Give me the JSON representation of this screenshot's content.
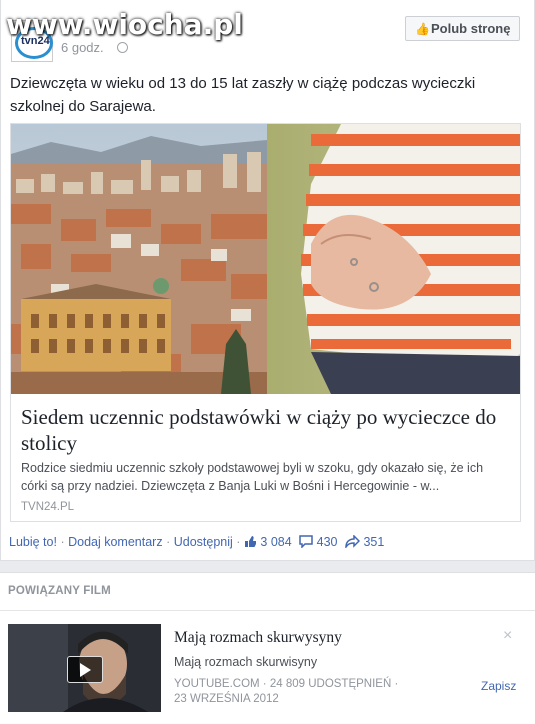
{
  "watermark": "www.wiocha.pl",
  "post": {
    "page_avatar_label": "tvn24",
    "timestamp": "6 godz.",
    "like_page_label": "Polub stronę",
    "status_text": "Dziewczęta w wieku od 13 do 15 lat zaszły w ciążę podczas wycieczki szkolnej do Sarajewa.",
    "link": {
      "title": "Siedem uczennic podstawówki w ciąży po wycieczce do stolicy",
      "description": "Rodzice siedmiu uczennic szkoły podstawowej byli w szoku, gdy okazało się, że ich córki są przy nadziei. Dziewczęta z Banja Luki w Bośni i Hercegowinie - w...",
      "source": "TVN24.PL"
    },
    "actions": {
      "like": "Lubię to!",
      "comment": "Dodaj komentarz",
      "share": "Udostępnij",
      "like_count": "3 084",
      "comment_count": "430",
      "share_count": "351"
    }
  },
  "related": {
    "heading": "POWIĄZANY FILM",
    "title": "Mają rozmach skurwysyny",
    "subtitle": "Mają rozmach skurwisyny",
    "meta": "YOUTUBE.COM · 24 809 UDOSTĘPNIEŃ · 23 WRZEŚNIA 2012",
    "close": "×",
    "save": "Zapisz"
  },
  "icons": {
    "like": "thumb-up-icon",
    "comment": "speech-bubble-icon",
    "share": "share-arrow-icon",
    "privacy": "globe-icon",
    "play": "play-icon",
    "close": "close-icon"
  },
  "colors": {
    "link_blue": "#4267b2",
    "meta_gray": "#90949c",
    "border": "#dddfe2"
  }
}
